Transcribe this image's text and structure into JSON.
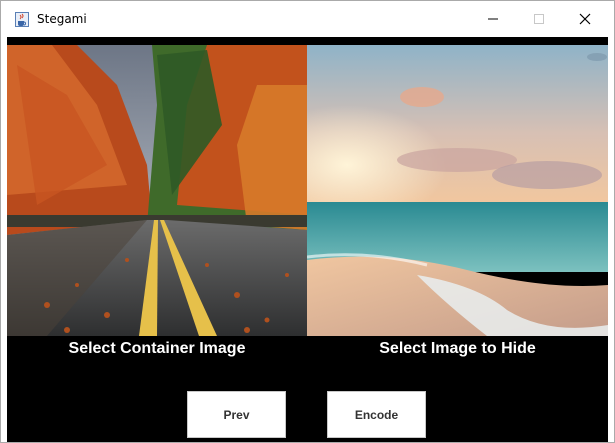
{
  "window": {
    "title": "Stegami",
    "icon": "java-cup-icon"
  },
  "panes": {
    "container": {
      "caption": "Select Container Image",
      "image": "autumn-road-photo"
    },
    "hide": {
      "caption": "Select Image to Hide",
      "image": "beach-sunset-photo"
    }
  },
  "buttons": {
    "prev_label": "Prev",
    "encode_label": "Encode"
  },
  "colors": {
    "background": "#000000",
    "caption_text": "#ffffff",
    "button_bg": "#ffffff"
  }
}
